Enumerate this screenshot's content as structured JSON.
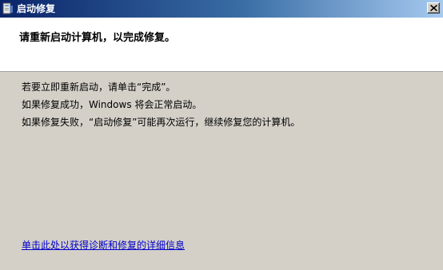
{
  "window": {
    "title": "启动修复",
    "icon": "startup-repair-icon",
    "close_glyph": "✕"
  },
  "header": {
    "heading": "请重新启动计算机，以完成修复。"
  },
  "body": {
    "lines": [
      "若要立即重新启动，请单击“完成”。",
      "如果修复成功，Windows 将会正常启动。",
      "如果修复失败，“启动修复”可能再次运行，继续修复您的计算机。"
    ]
  },
  "details_link": "单击此处以获得诊断和修复的详细信息",
  "colors": {
    "titlebar_start": "#0a246a",
    "titlebar_end": "#a6caf0",
    "dialog_bg": "#d4d0c8",
    "link": "#0000cc"
  }
}
